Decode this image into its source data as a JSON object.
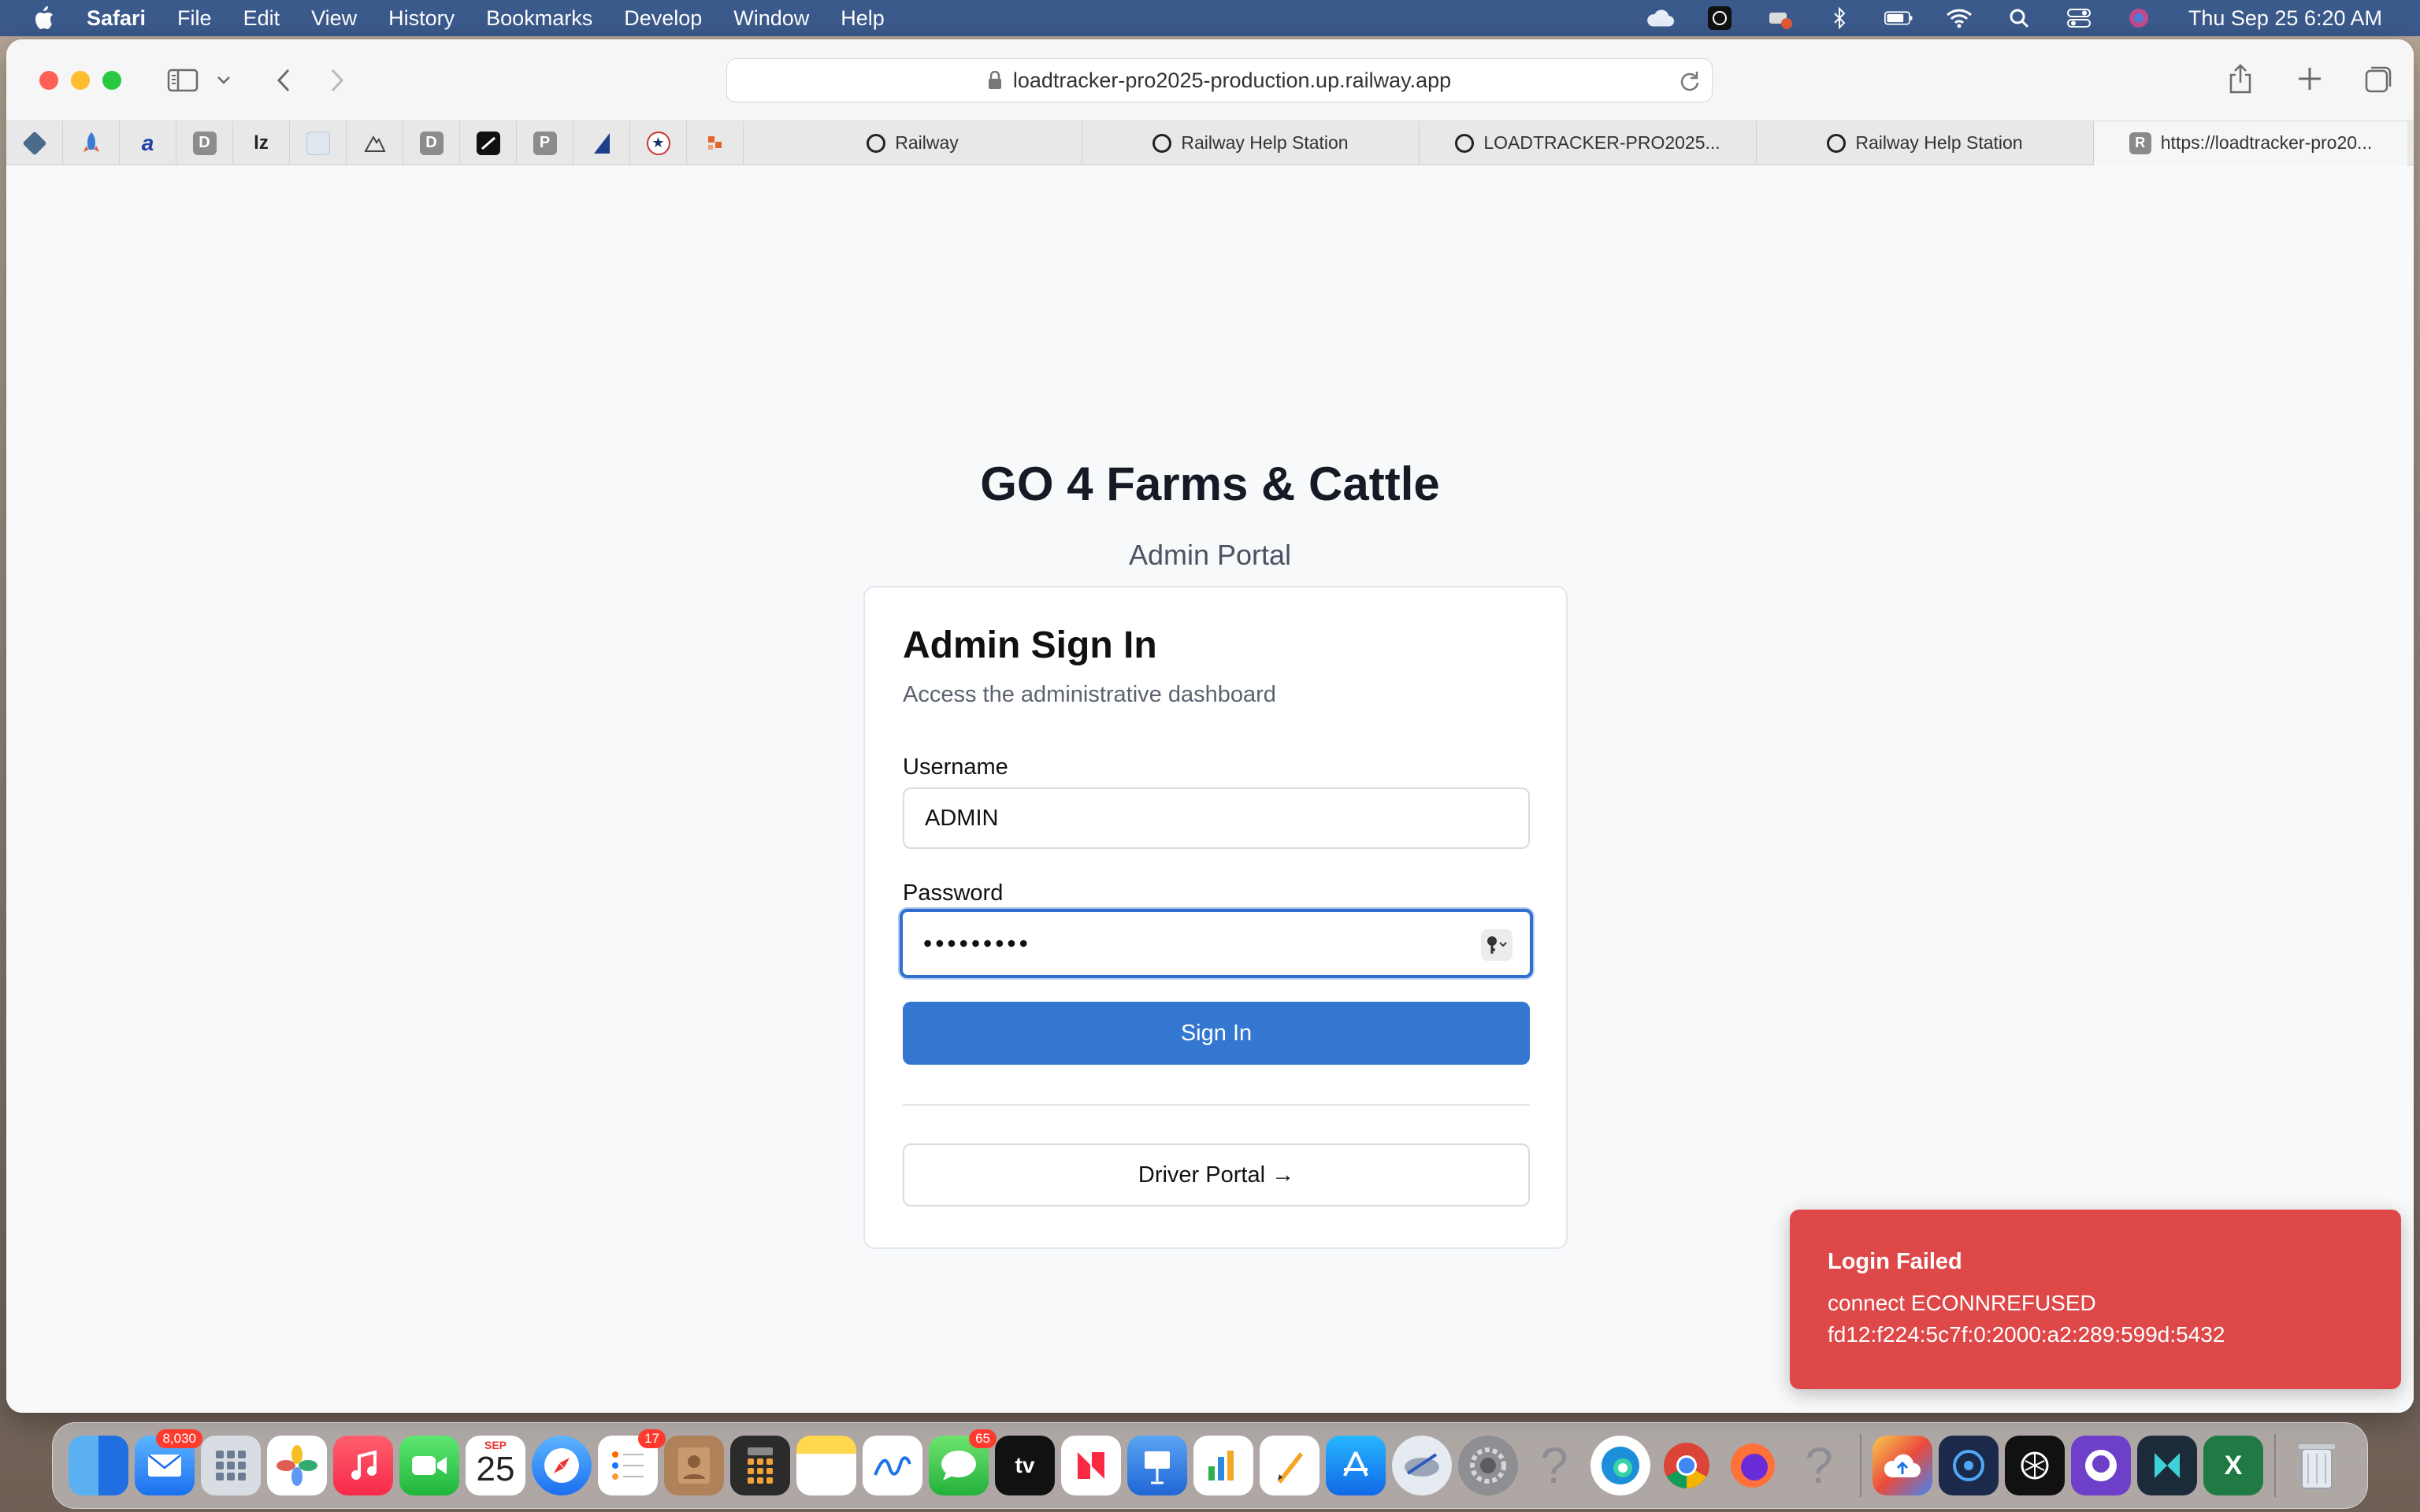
{
  "menubar": {
    "app_name": "Safari",
    "items": [
      "File",
      "Edit",
      "View",
      "History",
      "Bookmarks",
      "Develop",
      "Window",
      "Help"
    ],
    "clock": "Thu Sep 25  6:20 AM"
  },
  "browser": {
    "url": "loadtracker-pro2025-production.up.railway.app",
    "favorites": [
      {
        "icon": "layers-icon",
        "letter": "",
        "color": "#4a6b8a"
      },
      {
        "icon": "rocket-icon",
        "letter": "",
        "color": "#3a7bd5"
      },
      {
        "icon": "a-icon",
        "letter": "a",
        "color": "#2142a8"
      },
      {
        "icon": "d-icon",
        "letter": "D",
        "color": "#8c8c8c"
      },
      {
        "icon": "lz-icon",
        "letter": "lz",
        "color": "#222222"
      },
      {
        "icon": "doc-icon",
        "letter": "",
        "color": "#b9c7d6"
      },
      {
        "icon": "mountain-icon",
        "letter": "",
        "color": "#444444"
      },
      {
        "icon": "d-icon",
        "letter": "D",
        "color": "#8c8c8c"
      },
      {
        "icon": "slash-icon",
        "letter": "",
        "color": "#111111"
      },
      {
        "icon": "p-icon",
        "letter": "P",
        "color": "#8c8c8c"
      },
      {
        "icon": "sail-icon",
        "letter": "",
        "color": "#1d3f8c"
      },
      {
        "icon": "star-circle-icon",
        "letter": "★",
        "color": "#1b2f6b"
      },
      {
        "icon": "puzzle-icon",
        "letter": "",
        "color": "#e0662c"
      }
    ],
    "tabs": [
      {
        "label": "Railway",
        "active": false
      },
      {
        "label": "Railway Help Station",
        "active": false
      },
      {
        "label": "LOADTRACKER-PRO2025...",
        "active": false
      },
      {
        "label": "Railway Help Station",
        "active": false
      },
      {
        "label": "https://loadtracker-pro20...",
        "active": true
      }
    ]
  },
  "page": {
    "brand": "GO 4 Farms & Cattle",
    "subtitle": "Admin Portal",
    "card": {
      "title": "Admin Sign In",
      "description": "Access the administrative dashboard",
      "username_label": "Username",
      "username_value": "ADMIN",
      "password_label": "Password",
      "password_value": "•••••••••",
      "signin_label": "Sign In",
      "driver_portal_label": "Driver Portal →"
    }
  },
  "toast": {
    "title": "Login Failed",
    "line1": "connect ECONNREFUSED",
    "line2": "fd12:f224:5c7f:0:2000:a2:289:599d:5432"
  },
  "dock": {
    "mail_badge": "8,030",
    "reminders_badge": "17",
    "messages_badge": "65",
    "calendar_month": "SEP",
    "calendar_day": "25"
  }
}
